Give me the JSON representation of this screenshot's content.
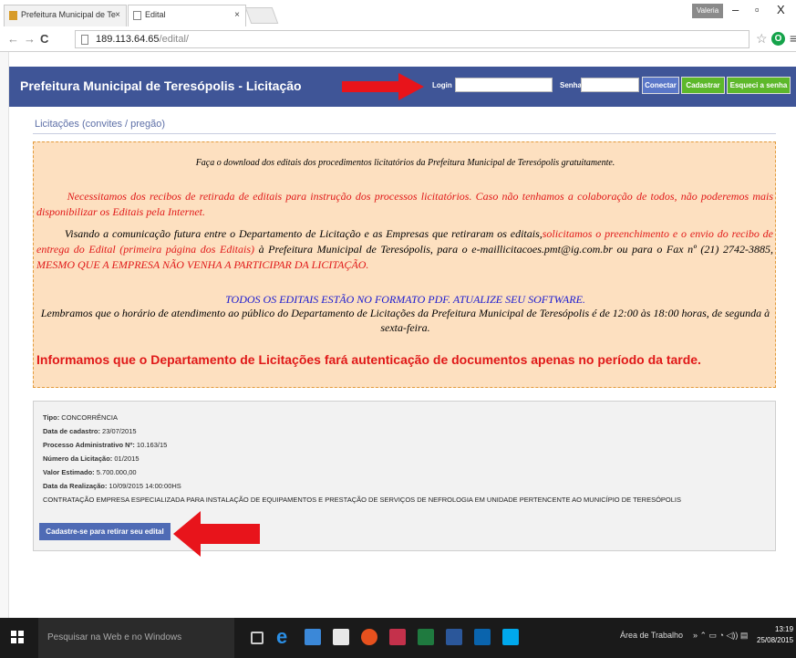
{
  "browser": {
    "tabs": [
      {
        "label": "Prefeitura Municipal de Te"
      },
      {
        "label": "Edital"
      }
    ],
    "user_chip": "Valeria",
    "url": {
      "host": "189.113.64.65",
      "path": "/edital/"
    }
  },
  "header": {
    "title": "Prefeitura Municipal de Teresópolis - Licitação",
    "login_label": "Login",
    "senha_label": "Senha",
    "login_value": "",
    "senha_value": "",
    "buttons": {
      "connect": "Conectar",
      "register": "Cadastrar",
      "forgot": "Esqueci a senha"
    }
  },
  "section": {
    "title": "Licitações (convites / pregão)"
  },
  "notice": {
    "intro": "Faça o download dos editais dos procedimentos licitatórios da Prefeitura Municipal de Teresópolis gratuitamente.",
    "para1": "Necessitamos dos recibos de retirada de editais para instrução dos processos licitatórios. Caso não tenhamos a colaboração de todos, não poderemos mais disponibilizar os Editais pela Internet.",
    "para2_a": "Visando a comunicação futura entre o Departamento de Licitação e as Empresas que retiraram os editais,",
    "para2_b": "solicitamos o preenchimento e o envio do recibo de entrega do Edital (primeira página dos Editais)",
    "para2_c": " à Prefeitura Municipal de Teresópolis, para o e-maillicitacoes.pmt@ig.com.br ou para o Fax nº (21) 2742-3885, ",
    "para2_d": "MESMO QUE A EMPRESA NÃO VENHA A PARTICIPAR DA LICITAÇÃO.",
    "pdf_notice": "TODOS OS EDITAIS ESTÃO NO FORMATO PDF. ATUALIZE SEU SOFTWARE.",
    "hours": "Lembramos que o horário de atendimento ao público do Departamento de Licitações da Prefeitura Municipal de Teresópolis é de 12:00 às 18:00 horas, de segunda à sexta-feira.",
    "auth": "Informamos que o Departamento de Licitações fará autenticação de documentos apenas no período da tarde."
  },
  "edital": {
    "tipo_label": "Tipo:",
    "tipo": "CONCORRÊNCIA",
    "data_cadastro_label": "Data de cadastro:",
    "data_cadastro": "23/07/2015",
    "processo_label": "Processo Administrativo Nº:",
    "processo": "10.163/15",
    "numero_label": "Número da Licitação:",
    "numero": "01/2015",
    "valor_label": "Valor Estimado:",
    "valor": "5.700.000,00",
    "realizacao_label": "Data da Realização:",
    "realizacao": "10/09/2015 14:00:00HS",
    "objeto": "CONTRATAÇÃO EMPRESA ESPECIALIZADA PARA INSTALAÇÃO DE EQUIPAMENTOS E PRESTAÇÃO DE SERVIÇOS DE NEFROLOGIA EM UNIDADE PERTENCENTE AO MUNICÍPIO DE TERESÓPOLIS",
    "register_button": "Cadastre-se para retirar seu edital"
  },
  "taskbar": {
    "search_placeholder": "Pesquisar na Web e no Windows",
    "desktop_label": "Área de Trabalho",
    "time": "13:19",
    "date": "25/08/2015"
  },
  "colors": {
    "header_bg": "#3f5597",
    "notice_bg": "#fde0c0",
    "red": "#e01818",
    "blue_text": "#1a1ad0",
    "green_btn": "#5db82b",
    "arrow": "#e8141b"
  }
}
